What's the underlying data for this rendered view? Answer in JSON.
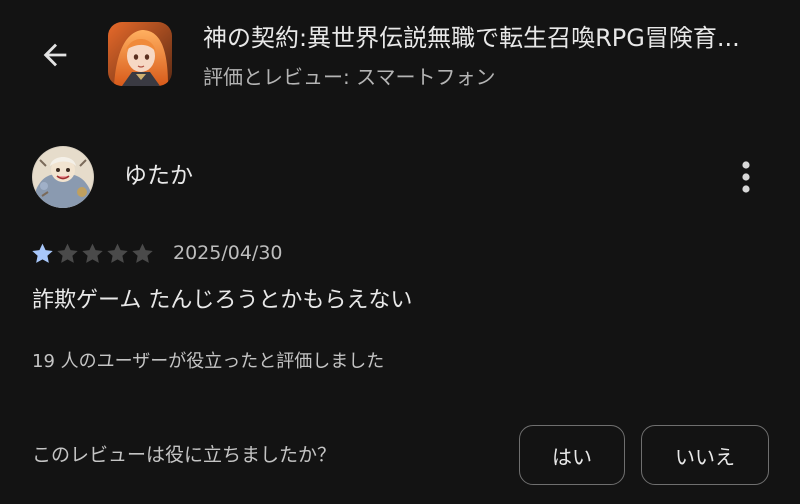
{
  "header": {
    "back_icon": "arrow-left-icon",
    "app_icon": "app-icon-anime-girl",
    "title": "神の契約:異世界伝説無職で転生召喚RPG冒険育...",
    "subtitle": "評価とレビュー: スマートフォン"
  },
  "review": {
    "avatar_icon": "user-avatar",
    "reviewer_name": "ゆたか",
    "more_icon": "more-vert-icon",
    "rating": 1,
    "max_rating": 5,
    "date": "2025/04/30",
    "body": "詐欺ゲーム たんじろうとかもらえない",
    "helpful_count": "19 人のユーザーが役立ったと評価しました",
    "helpful_question": "このレビューは役に立ちましたか？",
    "yes_label": "はい",
    "no_label": "いいえ"
  },
  "colors": {
    "background": "#131313",
    "star_filled": "#a8c7fa",
    "star_empty": "#4a4a4a",
    "button_border": "#6f6f6f"
  }
}
